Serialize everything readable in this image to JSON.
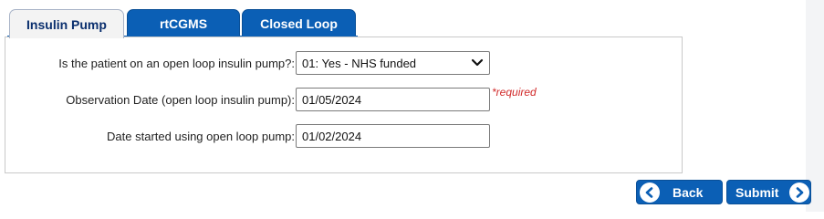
{
  "tabs": [
    {
      "label": "Insulin Pump",
      "active": true
    },
    {
      "label": "rtCGMS",
      "active": false
    },
    {
      "label": "Closed Loop",
      "active": false
    }
  ],
  "form": {
    "open_loop": {
      "label": "Is the patient on an open loop insulin pump?:",
      "value": "01: Yes - NHS funded"
    },
    "observation_date": {
      "label": "Observation Date (open loop insulin pump):",
      "value": "01/05/2024",
      "required_note": "*required"
    },
    "date_started": {
      "label": "Date started using open loop pump:",
      "value": "01/02/2024"
    }
  },
  "buttons": {
    "back": "Back",
    "submit": "Submit"
  },
  "colors": {
    "accent": "#0b5fb5",
    "required": "#d12a2a"
  },
  "icons": {
    "select": "chevron-down-icon",
    "back": "arrow-left-circle-icon",
    "submit": "arrow-right-circle-icon"
  }
}
